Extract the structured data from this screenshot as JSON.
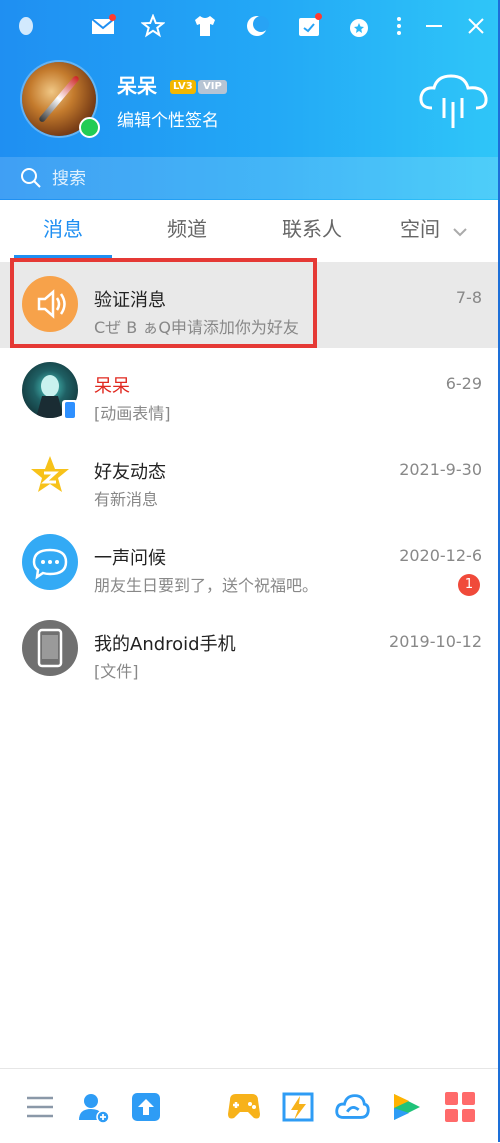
{
  "profile": {
    "nickname": "呆呆",
    "level_badge": "LV3",
    "vip_badge": "VIP",
    "signature": "编辑个性签名",
    "status": "online"
  },
  "search": {
    "placeholder": "搜索"
  },
  "tabs": [
    {
      "label": "消息",
      "active": true
    },
    {
      "label": "频道",
      "active": false
    },
    {
      "label": "联系人",
      "active": false
    },
    {
      "label": "空间",
      "active": false
    }
  ],
  "conversations": [
    {
      "title": "验证消息",
      "subtitle": "Cぜ B ぁQ申请添加你为好友",
      "time": "7-8",
      "selected": true,
      "icon": "speaker-icon"
    },
    {
      "title": "呆呆",
      "subtitle": "[动画表情]",
      "time": "6-29",
      "icon": "user-avatar",
      "device": "phone-icon"
    },
    {
      "title": "好友动态",
      "subtitle": "有新消息",
      "time": "2021-9-30",
      "icon": "qzone-star-icon"
    },
    {
      "title": "一声问候",
      "subtitle": "朋友生日要到了，送个祝福吧。",
      "time": "2020-12-6",
      "unread": "1",
      "icon": "chat-bubble-icon"
    },
    {
      "title": "我的Android手机",
      "subtitle": "[文件]",
      "time": "2019-10-12",
      "icon": "phone-icon"
    }
  ],
  "colors": {
    "brand_blue": "#1f8ff2",
    "highlight_red": "#e53935",
    "online_green": "#22cc55",
    "unread_red": "#f04a3a"
  },
  "titlebar_icons": [
    "qq-penguin-icon",
    "mail-icon",
    "star-icon",
    "shirt-icon",
    "moon-icon",
    "calendar-icon",
    "medal-icon",
    "more-icon",
    "minimize-icon",
    "close-icon"
  ],
  "bottom_icons": [
    "menu-icon",
    "add-friend-icon",
    "upload-icon",
    "game-icon",
    "tencent-docs-icon",
    "weiyun-icon",
    "video-icon",
    "apps-icon"
  ]
}
